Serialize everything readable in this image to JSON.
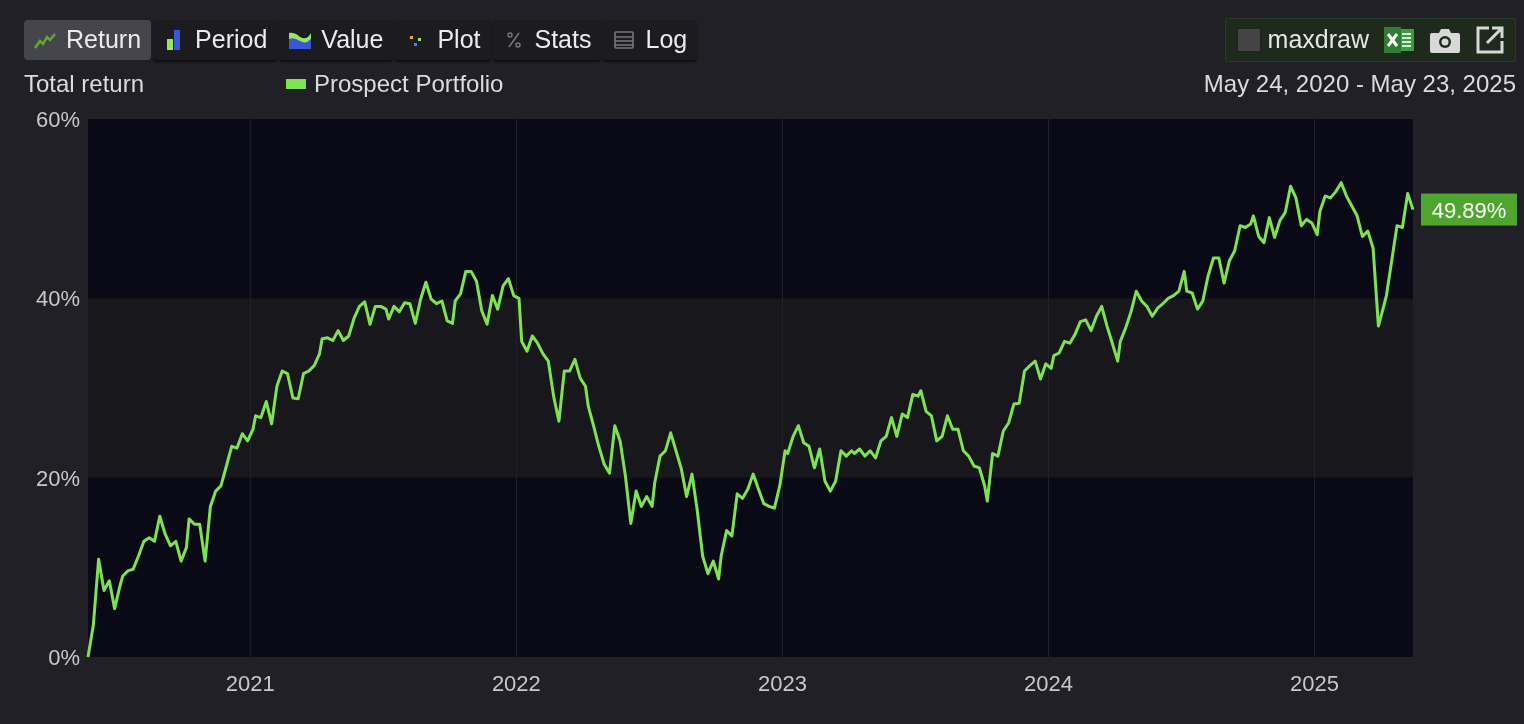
{
  "tabs": [
    {
      "label": "Return",
      "kind": "line",
      "selected": true
    },
    {
      "label": "Period",
      "kind": "bars",
      "selected": false
    },
    {
      "label": "Value",
      "kind": "area",
      "selected": false
    },
    {
      "label": "Plot",
      "kind": "dots",
      "selected": false
    },
    {
      "label": "Stats",
      "kind": "percent",
      "selected": false
    },
    {
      "label": "Log",
      "kind": "list",
      "selected": false
    }
  ],
  "tools": {
    "maxdraw": {
      "label": "maxdraw",
      "checked": false
    }
  },
  "chart": {
    "date_range": "May 24, 2020 - May 23, 2025",
    "last_value_label": "49.89%",
    "chart_data": {
      "type": "line",
      "title": "Total return",
      "xlim": [
        2020.39,
        2025.37
      ],
      "ylim": [
        0,
        60
      ],
      "xticks": [
        2021,
        2022,
        2023,
        2024,
        2025
      ],
      "bands": [
        {
          "axis": "y",
          "from": 20,
          "to": 40
        }
      ],
      "grid": {
        "x": true
      },
      "x": [
        2020.39,
        2020.41,
        2020.43,
        2020.45,
        2020.47,
        2020.49,
        2020.51,
        2020.52,
        2020.54,
        2020.56,
        2020.58,
        2020.6,
        2020.62,
        2020.64,
        2020.66,
        2020.68,
        2020.7,
        2020.72,
        2020.74,
        2020.76,
        2020.77,
        2020.79,
        2020.81,
        2020.83,
        2020.85,
        2020.87,
        2020.89,
        2020.91,
        2020.93,
        2020.95,
        2020.97,
        2020.99,
        2021.01,
        2021.02,
        2021.04,
        2021.06,
        2021.08,
        2021.1,
        2021.12,
        2021.14,
        2021.16,
        2021.18,
        2021.2,
        2021.22,
        2021.24,
        2021.26,
        2021.27,
        2021.29,
        2021.31,
        2021.33,
        2021.35,
        2021.37,
        2021.39,
        2021.41,
        2021.43,
        2021.45,
        2021.47,
        2021.49,
        2021.51,
        2021.52,
        2021.54,
        2021.56,
        2021.58,
        2021.6,
        2021.62,
        2021.64,
        2021.66,
        2021.68,
        2021.7,
        2021.72,
        2021.74,
        2021.76,
        2021.77,
        2021.79,
        2021.81,
        2021.83,
        2021.85,
        2021.87,
        2021.89,
        2021.91,
        2021.93,
        2021.95,
        2021.97,
        2021.99,
        2022.01,
        2022.02,
        2022.04,
        2022.06,
        2022.08,
        2022.1,
        2022.12,
        2022.14,
        2022.16,
        2022.18,
        2022.2,
        2022.22,
        2022.24,
        2022.26,
        2022.27,
        2022.29,
        2022.31,
        2022.33,
        2022.35,
        2022.37,
        2022.39,
        2022.41,
        2022.43,
        2022.45,
        2022.47,
        2022.49,
        2022.51,
        2022.52,
        2022.54,
        2022.56,
        2022.58,
        2022.6,
        2022.62,
        2022.64,
        2022.66,
        2022.68,
        2022.7,
        2022.72,
        2022.74,
        2022.76,
        2022.77,
        2022.79,
        2022.81,
        2022.83,
        2022.85,
        2022.87,
        2022.89,
        2022.91,
        2022.93,
        2022.95,
        2022.97,
        2022.99,
        2023.01,
        2023.02,
        2023.04,
        2023.06,
        2023.08,
        2023.1,
        2023.12,
        2023.14,
        2023.16,
        2023.18,
        2023.2,
        2023.22,
        2023.24,
        2023.26,
        2023.27,
        2023.29,
        2023.31,
        2023.33,
        2023.35,
        2023.37,
        2023.39,
        2023.41,
        2023.43,
        2023.45,
        2023.47,
        2023.49,
        2023.51,
        2023.52,
        2023.54,
        2023.56,
        2023.58,
        2023.6,
        2023.62,
        2023.64,
        2023.66,
        2023.68,
        2023.7,
        2023.72,
        2023.74,
        2023.76,
        2023.77,
        2023.79,
        2023.81,
        2023.83,
        2023.85,
        2023.87,
        2023.89,
        2023.91,
        2023.93,
        2023.95,
        2023.97,
        2023.99,
        2024.01,
        2024.02,
        2024.04,
        2024.06,
        2024.08,
        2024.1,
        2024.12,
        2024.14,
        2024.16,
        2024.18,
        2024.2,
        2024.22,
        2024.24,
        2024.26,
        2024.27,
        2024.29,
        2024.31,
        2024.33,
        2024.35,
        2024.37,
        2024.39,
        2024.41,
        2024.43,
        2024.45,
        2024.47,
        2024.49,
        2024.51,
        2024.52,
        2024.54,
        2024.56,
        2024.58,
        2024.6,
        2024.62,
        2024.64,
        2024.66,
        2024.68,
        2024.7,
        2024.72,
        2024.74,
        2024.76,
        2024.77,
        2024.79,
        2024.81,
        2024.83,
        2024.85,
        2024.87,
        2024.89,
        2024.91,
        2024.93,
        2024.95,
        2024.97,
        2024.99,
        2025.01,
        2025.02,
        2025.04,
        2025.06,
        2025.08,
        2025.1,
        2025.12,
        2025.14,
        2025.16,
        2025.18,
        2025.2,
        2025.22,
        2025.24,
        2025.26,
        2025.27,
        2025.29,
        2025.31,
        2025.33,
        2025.35,
        2025.37
      ],
      "yticks": [
        {
          "value": 0,
          "label": "0%"
        },
        {
          "value": 20,
          "label": "20%"
        },
        {
          "value": 40,
          "label": "40%"
        },
        {
          "value": 60,
          "label": "60%"
        }
      ],
      "series": [
        {
          "name": "Prospect Portfolio",
          "color": "#7ee34f",
          "values": [
            0,
            3.5,
            10.9,
            7.4,
            8.5,
            5.4,
            7.9,
            9,
            9.6,
            9.8,
            11.3,
            12.9,
            13.3,
            12.9,
            15.7,
            13.7,
            12.4,
            12.9,
            10.7,
            12.2,
            15.4,
            14.8,
            14.8,
            10.7,
            16.8,
            18.5,
            19.1,
            21.3,
            23.5,
            23.3,
            24.9,
            24.1,
            25.4,
            26.9,
            26.7,
            28.5,
            26,
            30.2,
            31.9,
            31.6,
            28.9,
            28.8,
            31.6,
            31.9,
            32.5,
            33.8,
            35.5,
            35.6,
            35.3,
            36.4,
            35.3,
            35.8,
            37.8,
            39.1,
            39.6,
            37.1,
            39.1,
            39.1,
            38.8,
            37.7,
            39.1,
            38.5,
            39.5,
            39.4,
            37.2,
            39.9,
            41.8,
            39.9,
            39.4,
            39.7,
            37.5,
            37.2,
            39.7,
            40.5,
            43,
            43,
            41.9,
            38.6,
            37.1,
            40.3,
            38.8,
            41.4,
            42.2,
            40.3,
            40,
            35.2,
            34.1,
            35.8,
            35,
            33.8,
            33,
            29.1,
            26.3,
            31.9,
            31.9,
            33.2,
            31.1,
            30.2,
            28,
            25.8,
            23.5,
            21.5,
            20.5,
            25.8,
            24.1,
            20.2,
            14.9,
            18.5,
            16.8,
            17.9,
            16.8,
            19.4,
            22.4,
            23,
            25,
            23,
            21,
            17.9,
            20.4,
            16.3,
            11.3,
            9.3,
            10.7,
            8.7,
            11.3,
            14.1,
            13.5,
            18.2,
            17.7,
            18.7,
            20.4,
            18.7,
            17.1,
            16.8,
            16.6,
            19.1,
            23,
            22.7,
            24.6,
            25.8,
            23.9,
            23.5,
            21.1,
            23.2,
            19.6,
            18.5,
            19.6,
            23,
            22.4,
            23,
            22.7,
            23.2,
            22.4,
            23,
            22.2,
            24.1,
            24.6,
            26.7,
            24.6,
            27.1,
            26.7,
            29.3,
            29.1,
            29.7,
            27.4,
            26.9,
            24.1,
            24.6,
            26.9,
            25.4,
            25.4,
            23,
            22.4,
            21.3,
            21.1,
            19.1,
            17.4,
            22.7,
            22.4,
            25.2,
            26.1,
            28.2,
            28.3,
            31.9,
            32.5,
            33,
            31,
            32.7,
            32.2,
            33.6,
            33.9,
            35.2,
            35,
            36,
            37.4,
            37.6,
            36.4,
            38,
            39.1,
            36.9,
            35,
            33,
            35.2,
            36.7,
            38.5,
            40.8,
            39.7,
            39.1,
            38,
            38.9,
            39.4,
            40,
            40.3,
            40.8,
            43,
            40.8,
            40.6,
            38.8,
            39.7,
            42.5,
            44.5,
            44.5,
            41.7,
            44.2,
            45.3,
            48.1,
            47.9,
            48.3,
            49.2,
            46.9,
            46.2,
            49,
            46.8,
            48.7,
            49.6,
            52.5,
            51.2,
            48.1,
            48.8,
            48.4,
            47.1,
            49.7,
            51.4,
            51.2,
            51.9,
            52.9,
            51.4,
            50.3,
            49.2,
            46.9,
            47.5,
            45.6,
            36.9,
            39.1,
            40.3,
            44.2,
            48.1,
            47.9,
            51.7,
            49.9
          ]
        }
      ]
    }
  }
}
